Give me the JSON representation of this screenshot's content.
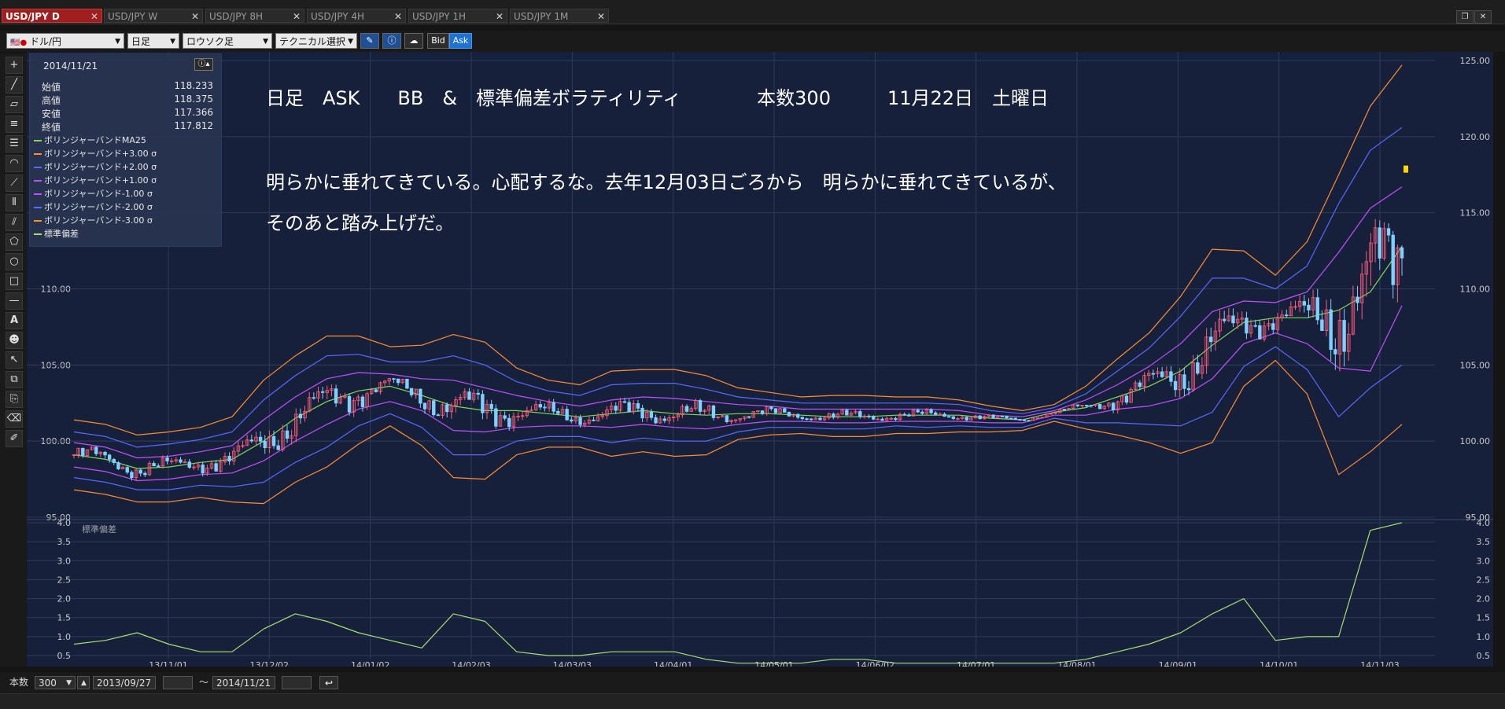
{
  "tabs": [
    {
      "label": "USD/JPY D",
      "active": true
    },
    {
      "label": "USD/JPY W",
      "active": false
    },
    {
      "label": "USD/JPY 8H",
      "active": false
    },
    {
      "label": "USD/JPY 4H",
      "active": false
    },
    {
      "label": "USD/JPY 1H",
      "active": false
    },
    {
      "label": "USD/JPY 1M",
      "active": false
    }
  ],
  "toolbar": {
    "currency": "ドル/円",
    "period": "日足",
    "chart_type": "ロウソク足",
    "technical": "テクニカル選択",
    "bid": "Bid",
    "ask": "Ask"
  },
  "infobox": {
    "date": "2014/11/21",
    "ohlc": [
      {
        "label": "始値",
        "value": "118.233"
      },
      {
        "label": "高値",
        "value": "118.375"
      },
      {
        "label": "安値",
        "value": "117.366"
      },
      {
        "label": "終値",
        "value": "117.812"
      }
    ],
    "legend": [
      {
        "label": "ボリンジャーバンドMA25",
        "color": "#7ed957"
      },
      {
        "label": "ボリンジャーバンド+3.00 σ",
        "color": "#ff8c30"
      },
      {
        "label": "ボリンジャーバンド+2.00 σ",
        "color": "#5a68ff"
      },
      {
        "label": "ボリンジャーバンド+1.00 σ",
        "color": "#c050ff"
      },
      {
        "label": "ボリンジャーバンド-1.00 σ",
        "color": "#c050ff"
      },
      {
        "label": "ボリンジャーバンド-2.00 σ",
        "color": "#5a68ff"
      },
      {
        "label": "ボリンジャーバンド-3.00 σ",
        "color": "#ff8c30"
      },
      {
        "label": "標準偏差",
        "color": "#a8e070"
      }
    ]
  },
  "annotation": {
    "line1": "日足　ASK　　BB　&　標準偏差ボラティリティ　　　　本数300　　　11月22日　土曜日",
    "line2": "明らかに垂れてきている。心配するな。去年12月03日ごろから　明らかに垂れてきているが、",
    "line3": "そのあと踏み上げだ。"
  },
  "chart_data": [
    {
      "type": "line",
      "ylim": [
        95,
        125
      ],
      "yticks_left": [
        "110.00",
        "105.00",
        "100.00",
        "95.00"
      ],
      "yticks_right": [
        "125.00",
        "120.00",
        "115.00",
        "110.00",
        "105.00",
        "100.00",
        "95.00"
      ],
      "xticks": [
        "13/11/01",
        "13/12/02",
        "14/01/02",
        "14/02/03",
        "14/03/03",
        "14/04/01",
        "14/05/01",
        "14/06/02",
        "14/07/01",
        "14/08/01",
        "14/09/01",
        "14/10/01",
        "14/11/03"
      ],
      "series": [
        {
          "name": "ボリンジャーバンドMA25",
          "color": "#7ed957",
          "values": [
            99.1,
            98.8,
            98.2,
            98.3,
            98.6,
            98.8,
            100.0,
            101.5,
            102.6,
            103.3,
            103.6,
            103.0,
            102.3,
            102.0,
            102.0,
            101.8,
            101.6,
            101.8,
            102.0,
            101.8,
            101.7,
            101.8,
            101.8,
            101.7,
            101.6,
            101.6,
            101.7,
            101.7,
            101.7,
            101.5,
            101.4,
            101.9,
            102.2,
            102.9,
            103.6,
            104.6,
            106.3,
            107.8,
            108.1,
            108.1,
            108.6,
            109.8,
            112.8
          ]
        },
        {
          "name": "ボリンジャーバンド+3.00 σ",
          "color": "#ff8c30",
          "values": [
            101.4,
            101.1,
            100.4,
            100.6,
            100.9,
            101.6,
            104.0,
            105.6,
            106.9,
            106.9,
            106.2,
            106.3,
            107.0,
            106.5,
            104.8,
            104.0,
            103.7,
            104.6,
            104.7,
            104.7,
            104.3,
            103.5,
            103.2,
            102.9,
            103.0,
            103.0,
            102.9,
            102.9,
            102.7,
            102.3,
            102.0,
            102.4,
            103.6,
            105.4,
            107.1,
            109.5,
            112.6,
            112.5,
            110.9,
            113.1,
            117.5,
            122.0,
            124.7
          ]
        },
        {
          "name": "ボリンジャーバンド+2.00 σ",
          "color": "#5a68ff",
          "values": [
            100.6,
            100.3,
            99.6,
            99.8,
            100.1,
            100.6,
            102.7,
            104.3,
            105.6,
            105.7,
            105.2,
            105.2,
            105.6,
            105.0,
            103.9,
            103.3,
            103.0,
            103.7,
            103.8,
            103.8,
            103.4,
            102.9,
            102.7,
            102.5,
            102.5,
            102.5,
            102.5,
            102.5,
            102.4,
            102.0,
            101.8,
            102.2,
            103.1,
            104.6,
            106.1,
            108.2,
            110.7,
            110.7,
            110.0,
            111.5,
            115.6,
            119.1,
            120.6
          ]
        },
        {
          "name": "ボリンジャーバンド+1.00 σ",
          "color": "#c050ff",
          "values": [
            99.9,
            99.6,
            98.9,
            99.0,
            99.3,
            99.7,
            101.4,
            102.9,
            104.1,
            104.5,
            104.4,
            104.1,
            104.0,
            103.5,
            103.0,
            102.6,
            102.3,
            102.7,
            102.9,
            102.8,
            102.6,
            102.4,
            102.3,
            102.1,
            102.1,
            102.1,
            102.1,
            102.1,
            102.0,
            101.7,
            101.6,
            102.0,
            102.7,
            103.7,
            104.9,
            106.4,
            108.5,
            109.2,
            109.1,
            109.8,
            112.4,
            115.3,
            116.7
          ]
        },
        {
          "name": "ボリンジャーバンド-1.00 σ",
          "color": "#c050ff",
          "values": [
            98.3,
            98.0,
            97.4,
            97.5,
            97.8,
            97.9,
            98.7,
            100.0,
            101.1,
            102.1,
            102.6,
            102.0,
            100.7,
            100.6,
            100.9,
            101.0,
            101.0,
            100.9,
            101.1,
            100.9,
            100.8,
            101.1,
            101.3,
            101.3,
            101.2,
            101.2,
            101.3,
            101.3,
            101.3,
            101.2,
            101.2,
            101.7,
            101.7,
            102.1,
            102.3,
            102.8,
            104.1,
            106.4,
            107.1,
            106.4,
            104.8,
            104.6,
            108.9
          ]
        },
        {
          "name": "ボリンジャーバンド-2.00 σ",
          "color": "#5a68ff",
          "values": [
            97.6,
            97.3,
            96.8,
            96.8,
            97.1,
            97.0,
            97.3,
            98.6,
            99.6,
            101.0,
            101.8,
            100.9,
            99.1,
            99.1,
            100.0,
            100.3,
            100.3,
            99.9,
            100.2,
            100.0,
            100.0,
            100.6,
            100.9,
            100.9,
            100.8,
            100.8,
            101.0,
            100.9,
            101.0,
            100.9,
            100.9,
            101.5,
            101.2,
            101.2,
            101.1,
            101.0,
            101.9,
            104.9,
            106.2,
            104.7,
            101.6,
            103.5,
            105.0
          ]
        },
        {
          "name": "ボリンジャーバンド-3.00 σ",
          "color": "#ff8c30",
          "values": [
            96.8,
            96.5,
            96.0,
            96.0,
            96.3,
            96.0,
            95.9,
            97.3,
            98.3,
            99.8,
            101.0,
            99.7,
            97.6,
            97.5,
            99.1,
            99.6,
            99.6,
            99.0,
            99.3,
            99.0,
            99.1,
            100.1,
            100.4,
            100.5,
            100.3,
            100.3,
            100.5,
            100.5,
            100.6,
            100.6,
            100.7,
            101.3,
            100.8,
            100.4,
            99.9,
            99.2,
            99.9,
            103.6,
            105.3,
            103.1,
            97.8,
            99.3,
            101.1
          ]
        },
        {
          "name": "標準偏差",
          "color": "#a8e070",
          "values": [
            0.8,
            0.9,
            1.1,
            0.8,
            0.6,
            0.6,
            1.2,
            1.6,
            1.4,
            1.1,
            0.9,
            0.7,
            1.6,
            1.4,
            0.6,
            0.5,
            0.5,
            0.6,
            0.6,
            0.6,
            0.4,
            0.3,
            0.3,
            0.3,
            0.4,
            0.4,
            0.3,
            0.3,
            0.3,
            0.3,
            0.3,
            0.3,
            0.4,
            0.6,
            0.8,
            1.1,
            1.6,
            2.0,
            0.9,
            1.0,
            1.0,
            3.8,
            4.0
          ]
        }
      ]
    },
    {
      "type": "line",
      "title": "標準偏差",
      "ylim": [
        0.5,
        4.0
      ],
      "yticks": [
        "4.0",
        "3.5",
        "3.0",
        "2.5",
        "2.0",
        "1.5",
        "1.0",
        "0.5"
      ]
    }
  ],
  "bottombar": {
    "label": "本数",
    "count": "300",
    "from_date": "2013/09/27",
    "tilde": "〜",
    "to_date": "2014/11/21"
  }
}
